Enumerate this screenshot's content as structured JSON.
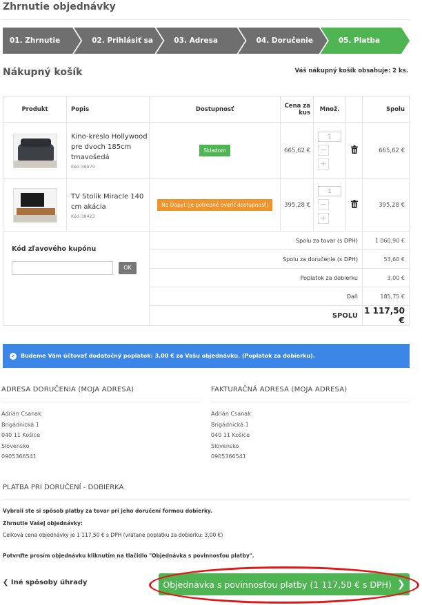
{
  "page_title": "Zhrnutie objednávky",
  "steps": [
    "01. Zhrnutie",
    "02. Prihlásiť sa",
    "03. Adresa",
    "04. Doručenie",
    "05. Platba"
  ],
  "cart": {
    "heading": "Nákupný košík",
    "count_text": "Váš nákupný košík obsahuje: 2 ks.",
    "columns": [
      "Produkt",
      "Popis",
      "Dostupnosť",
      "Cena za kus",
      "Množ.",
      "",
      "Spolu"
    ],
    "items": [
      {
        "name": "Kino-kreslo Hollywood pre dvoch 185cm tmavošedá",
        "code": "Kód:39979",
        "availability": "Skladom",
        "price": "665,62 €",
        "qty": "1",
        "total": "665,62 €"
      },
      {
        "name": "TV Stolík Miracle 140 cm akácia",
        "code": "Kód:38423",
        "availability": "Na Dopyt (je potrebné overiť dostupnosť)",
        "price": "395,28 €",
        "qty": "1",
        "total": "395,28 €"
      }
    ],
    "coupon_label": "Kód zľavového kupónu",
    "coupon_placeholder": "",
    "ok_label": "OK",
    "summary": [
      {
        "label": "Spolu za tovar (s DPH)",
        "value": "1 060,90 €"
      },
      {
        "label": "Spolu za doručenie (s DPH)",
        "value": "53,60 €"
      },
      {
        "label": "Poplatok za dobierku",
        "value": "3,00 €"
      },
      {
        "label": "Daň",
        "value": "185,75 €"
      }
    ],
    "grand_label": "SPOLU",
    "grand_value": "1 117,50 €"
  },
  "info_bar": "Budeme Vám účtovať dodatočný poplatok: 3,00 € za Vašu objednávku. (Poplatok za dobierku).",
  "delivery_address": {
    "title": "ADRESA DORUČENIA (MOJA ADRESA)",
    "lines": [
      "Adrián Csanak",
      "Brigádnická 1",
      "040 11 Košice",
      "Slovensko",
      "0905366541"
    ]
  },
  "billing_address": {
    "title": "FAKTURAČNÁ ADRESA (MOJA ADRESA)",
    "lines": [
      "Adrián Csanak",
      "Brigádnická 1",
      "040 11 Košice",
      "Slovensko",
      "0905366541"
    ]
  },
  "payment": {
    "title": "PLATBA PRI DORUČENÍ - DOBIERKA",
    "chosen": "Vybrali ste si spôsob platby za tovar pri jeho doručení formou dobierky.",
    "summary_heading": "Zhrnutie Vašej objednávky:",
    "summary_text": "Celková cena objednávky je 1 117,50 € s DPH (vrátane poplatku za dobierku: 3,00 €)",
    "confirm_text": "Potvrďte prosím objednávku kliknutím na tlačidlo \"Objednávka s povinnosťou platby\"."
  },
  "back_link": "Iné spôsoby úhrady",
  "submit_label": "Objednávka s povinnosťou platby (1 117,50 € s DPH)",
  "colors": {
    "accent": "#4fb553",
    "info": "#3b86e6",
    "warning": "#f0932b",
    "highlight": "#e01818"
  }
}
